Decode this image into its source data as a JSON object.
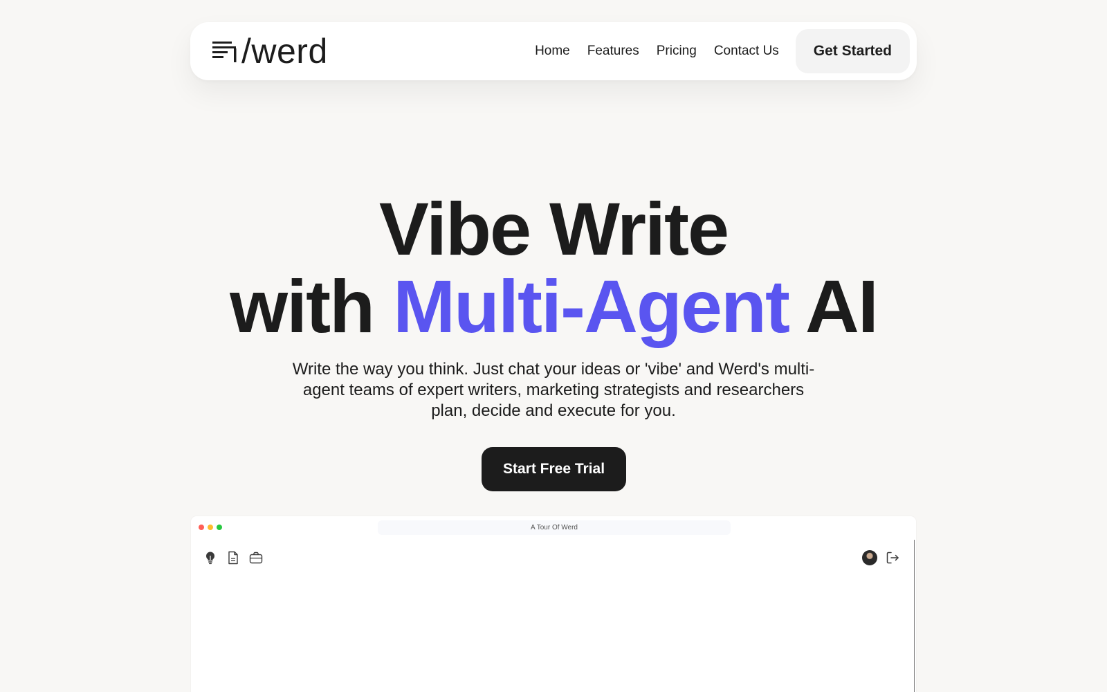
{
  "nav": {
    "logo_text": "/werd",
    "links": [
      "Home",
      "Features",
      "Pricing",
      "Contact Us"
    ],
    "cta_label": "Get Started"
  },
  "hero": {
    "title_line1": "Vibe Write",
    "title_line2_prefix": "with",
    "title_line2_accent": "Multi-Agent",
    "title_line2_suffix": "AI",
    "subtitle": "Write the way you think. Just chat your ideas or 'vibe' and Werd's multi-agent teams of expert writers, marketing strategists and researchers plan, decide and execute for you.",
    "cta_label": "Start Free Trial"
  },
  "app_preview": {
    "window_title": "A Tour Of Werd",
    "toolbar_left_icons": [
      "lightbulb-icon",
      "document-icon",
      "briefcase-icon"
    ],
    "toolbar_right_icons": [
      "avatar",
      "logout-icon"
    ]
  },
  "colors": {
    "accent": "#5a55f0",
    "dark": "#1c1c1c",
    "background": "#f8f7f5"
  }
}
